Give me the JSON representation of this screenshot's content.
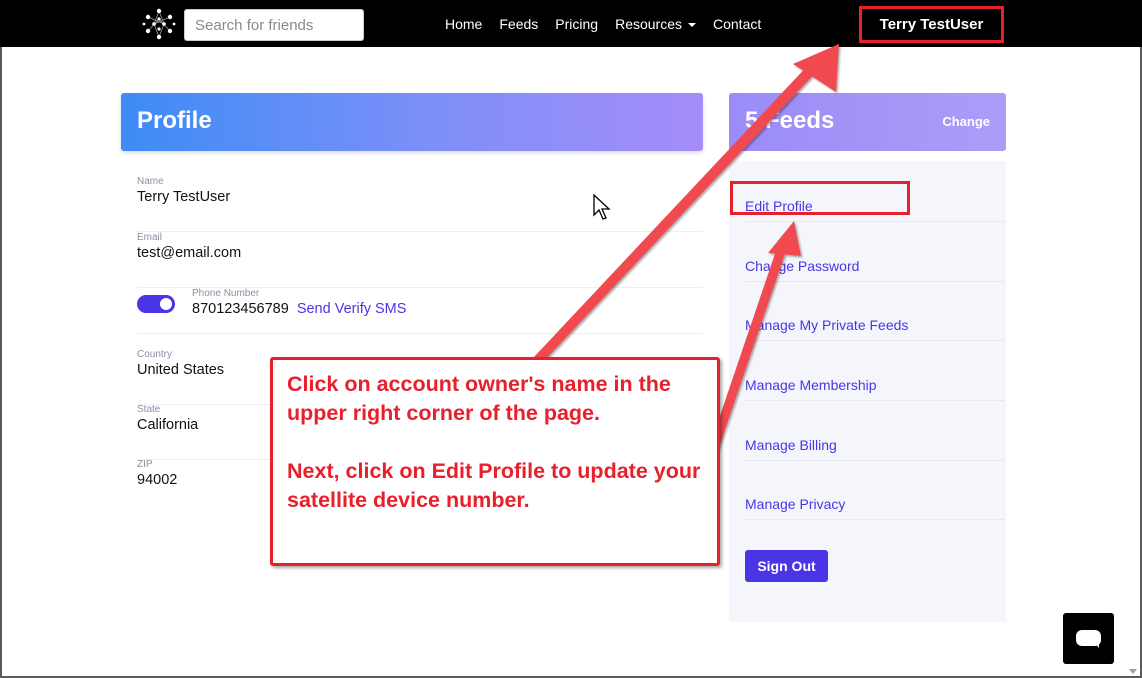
{
  "navbar": {
    "search_placeholder": "Search for friends",
    "links": [
      "Home",
      "Feeds",
      "Pricing",
      "Resources",
      "Contact"
    ],
    "user_name": "Terry TestUser"
  },
  "profile": {
    "title": "Profile",
    "name_label": "Name",
    "name_value": "Terry TestUser",
    "email_label": "Email",
    "email_value": "test@email.com",
    "phone_label": "Phone Number",
    "phone_value": "870123456789",
    "phone_toggle_on": true,
    "verify_link": "Send Verify SMS",
    "country_label": "Country",
    "country_value": "United States",
    "state_label": "State",
    "state_value": "California",
    "zip_label": "ZIP",
    "zip_value": "94002"
  },
  "feeds": {
    "title": "5 Feeds",
    "change_label": "Change",
    "menu": [
      "Edit Profile",
      "Change Password",
      "Manage My Private Feeds",
      "Manage Membership",
      "Manage Billing",
      "Manage Privacy"
    ],
    "sign_out": "Sign Out"
  },
  "callout": {
    "text": "Click on account owner's name in the upper right corner of the page.\n\nNext, click on Edit Profile to update your satellite device number."
  },
  "colors": {
    "accent": "#4a35e6",
    "annotation_red": "#e8202b",
    "navbar_bg": "#000000"
  },
  "icons": [
    "logo-icon",
    "caret-down-icon",
    "chat-icon",
    "cursor-icon"
  ]
}
